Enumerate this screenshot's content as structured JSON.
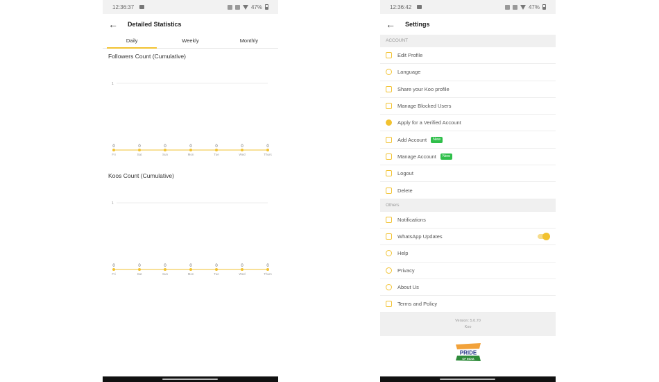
{
  "left": {
    "status_time": "12:36:37",
    "status_battery": "47%",
    "title": "Detailed Statistics",
    "tabs": [
      "Daily",
      "Weekly",
      "Monthly"
    ],
    "active_tab": "Daily",
    "accent": "#f2c230"
  },
  "right": {
    "status_time": "12:36:42",
    "status_battery": "47%",
    "title": "Settings",
    "account_header": "ACCOUNT",
    "account_items": [
      {
        "label": "Edit Profile",
        "icon": "user-icon"
      },
      {
        "label": "Language",
        "icon": "globe-icon"
      },
      {
        "label": "Share your Koo profile",
        "icon": "share-icon"
      },
      {
        "label": "Manage Blocked Users",
        "icon": "blocked-icon"
      },
      {
        "label": "Apply for a Verified Account",
        "icon": "verified-icon"
      },
      {
        "label": "Add Account",
        "icon": "add-user-icon",
        "badge": "New"
      },
      {
        "label": "Manage Account",
        "icon": "manage-user-icon",
        "badge": "New"
      },
      {
        "label": "Logout",
        "icon": "logout-icon"
      },
      {
        "label": "Delete",
        "icon": "trash-icon"
      }
    ],
    "others_header": "Others",
    "other_items": [
      {
        "label": "Notifications",
        "icon": "bell-icon"
      },
      {
        "label": "WhatsApp Updates",
        "icon": "whatsapp-icon",
        "toggle": true
      },
      {
        "label": "Help",
        "icon": "help-icon"
      },
      {
        "label": "Privacy",
        "icon": "privacy-icon"
      },
      {
        "label": "About Us",
        "icon": "info-icon"
      },
      {
        "label": "Terms and Policy",
        "icon": "document-icon"
      }
    ],
    "version_line1": "Version: 5.0.70",
    "version_line2": "Koo",
    "logo_top": "PRIDE",
    "logo_bottom": "OF INDIA"
  },
  "chart_data": [
    {
      "type": "line",
      "title": "Followers Count (Cumulative)",
      "categories": [
        "Fri",
        "Sat",
        "Sun",
        "Mon",
        "Tue",
        "Wed",
        "Thurs"
      ],
      "values": [
        0,
        0,
        0,
        0,
        0,
        0,
        0
      ],
      "ylim": [
        0,
        1
      ],
      "yticks": [
        "1"
      ],
      "color": "#f2c230"
    },
    {
      "type": "line",
      "title": "Koos Count (Cumulative)",
      "categories": [
        "Fri",
        "Sat",
        "Sun",
        "Mon",
        "Tue",
        "Wed",
        "Thurs"
      ],
      "values": [
        0,
        0,
        0,
        0,
        0,
        0,
        0
      ],
      "ylim": [
        0,
        1
      ],
      "yticks": [
        "1"
      ],
      "color": "#f2c230"
    }
  ]
}
